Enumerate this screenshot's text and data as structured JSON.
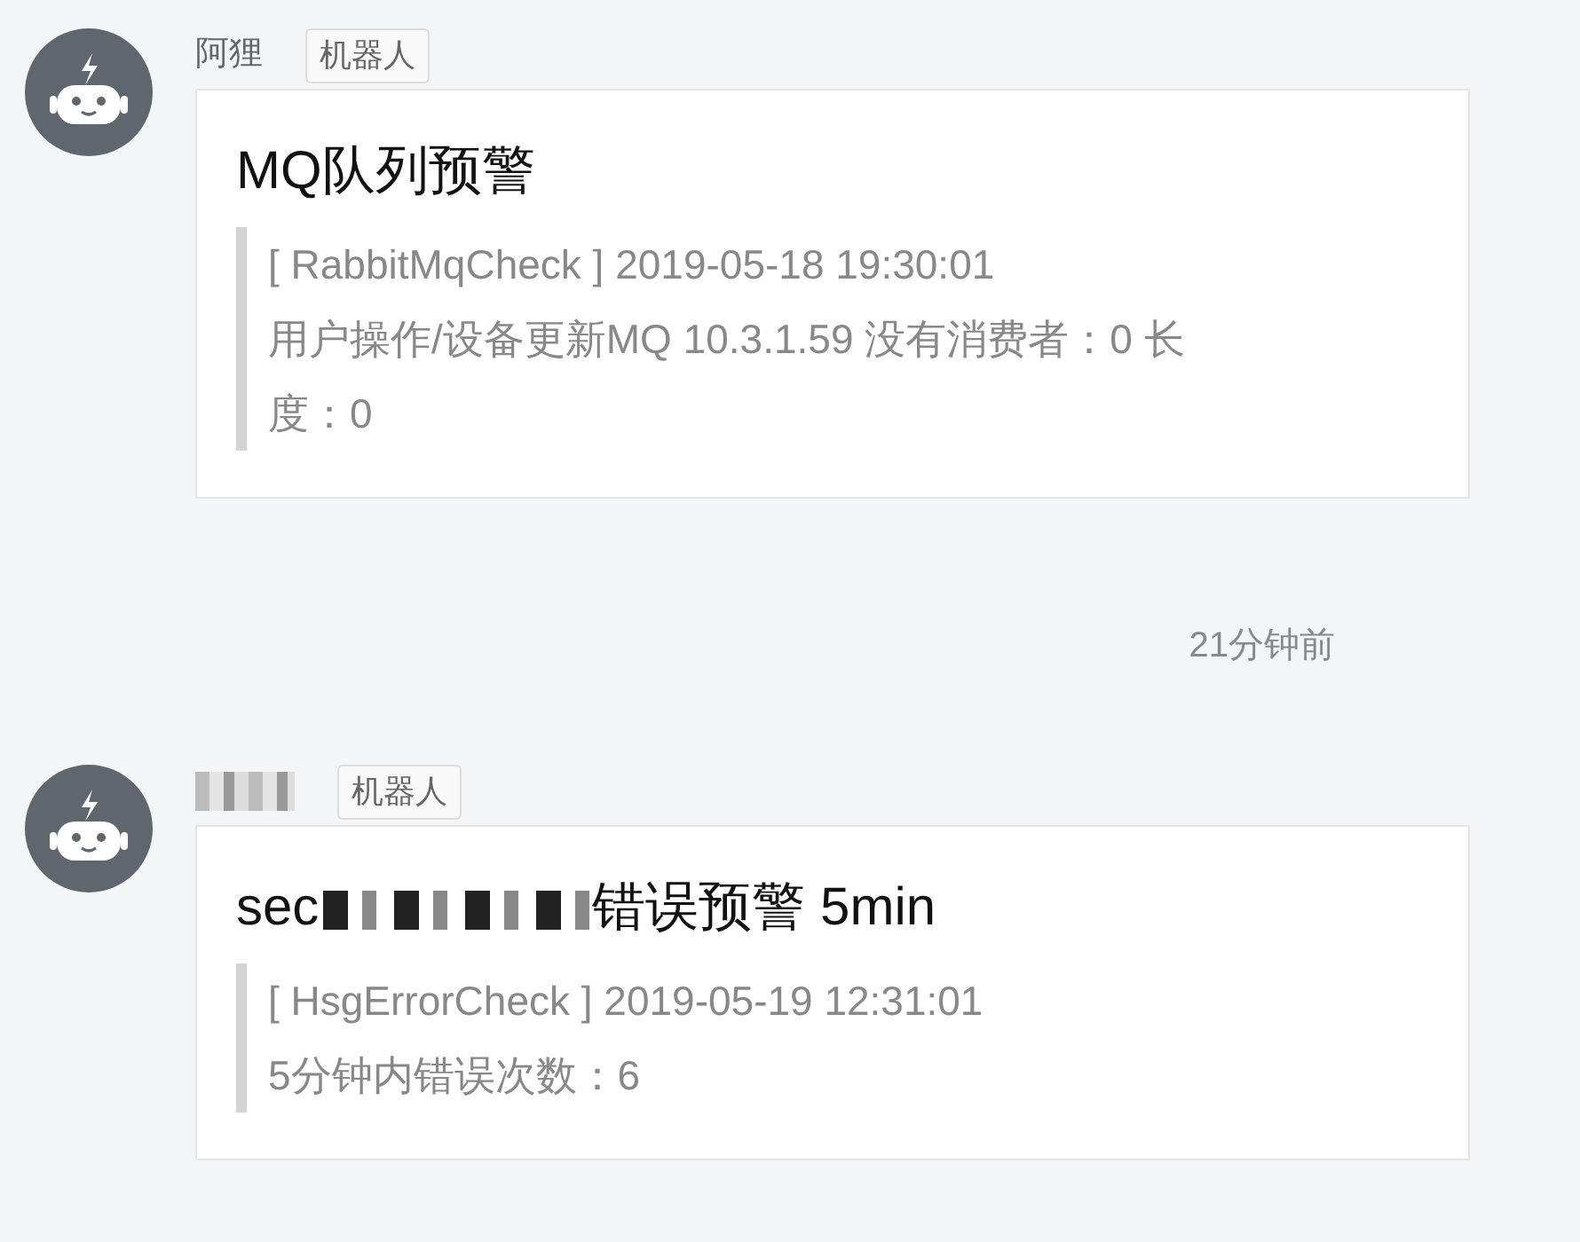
{
  "messages": [
    {
      "sender": "阿狸",
      "tag": "机器人",
      "title": "MQ队列预警",
      "lines": [
        "[ RabbitMqCheck ] 2019-05-18 19:30:01",
        "用户操作/设备更新MQ 10.3.1.59 没有消费者：0 长度：0"
      ],
      "time": "21分钟前"
    },
    {
      "sender_redacted": true,
      "tag": "机器人",
      "title": "sec",
      "title_redacted_after": "错误预警 5min",
      "lines": [
        "[ HsgErrorCheck ] 2019-05-19 12:31:01",
        "5分钟内错误次数：6"
      ]
    }
  ]
}
